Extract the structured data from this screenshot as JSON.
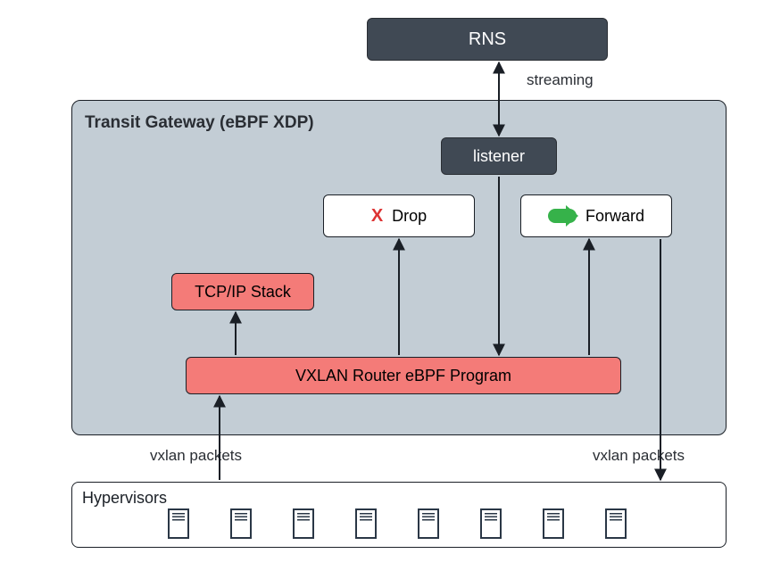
{
  "rns": {
    "label": "RNS"
  },
  "streaming_label": "streaming",
  "gateway": {
    "title": "Transit Gateway (eBPF XDP)",
    "listener": {
      "label": "listener"
    },
    "drop": {
      "label": "Drop"
    },
    "forward": {
      "label": "Forward"
    },
    "tcpip": {
      "label": "TCP/IP Stack"
    },
    "vxlan_router": {
      "label": "VXLAN Router eBPF Program"
    }
  },
  "vxlan_in_label": "vxlan packets",
  "vxlan_out_label": "vxlan packets",
  "hypervisors": {
    "title": "Hypervisors",
    "count": 8
  }
}
